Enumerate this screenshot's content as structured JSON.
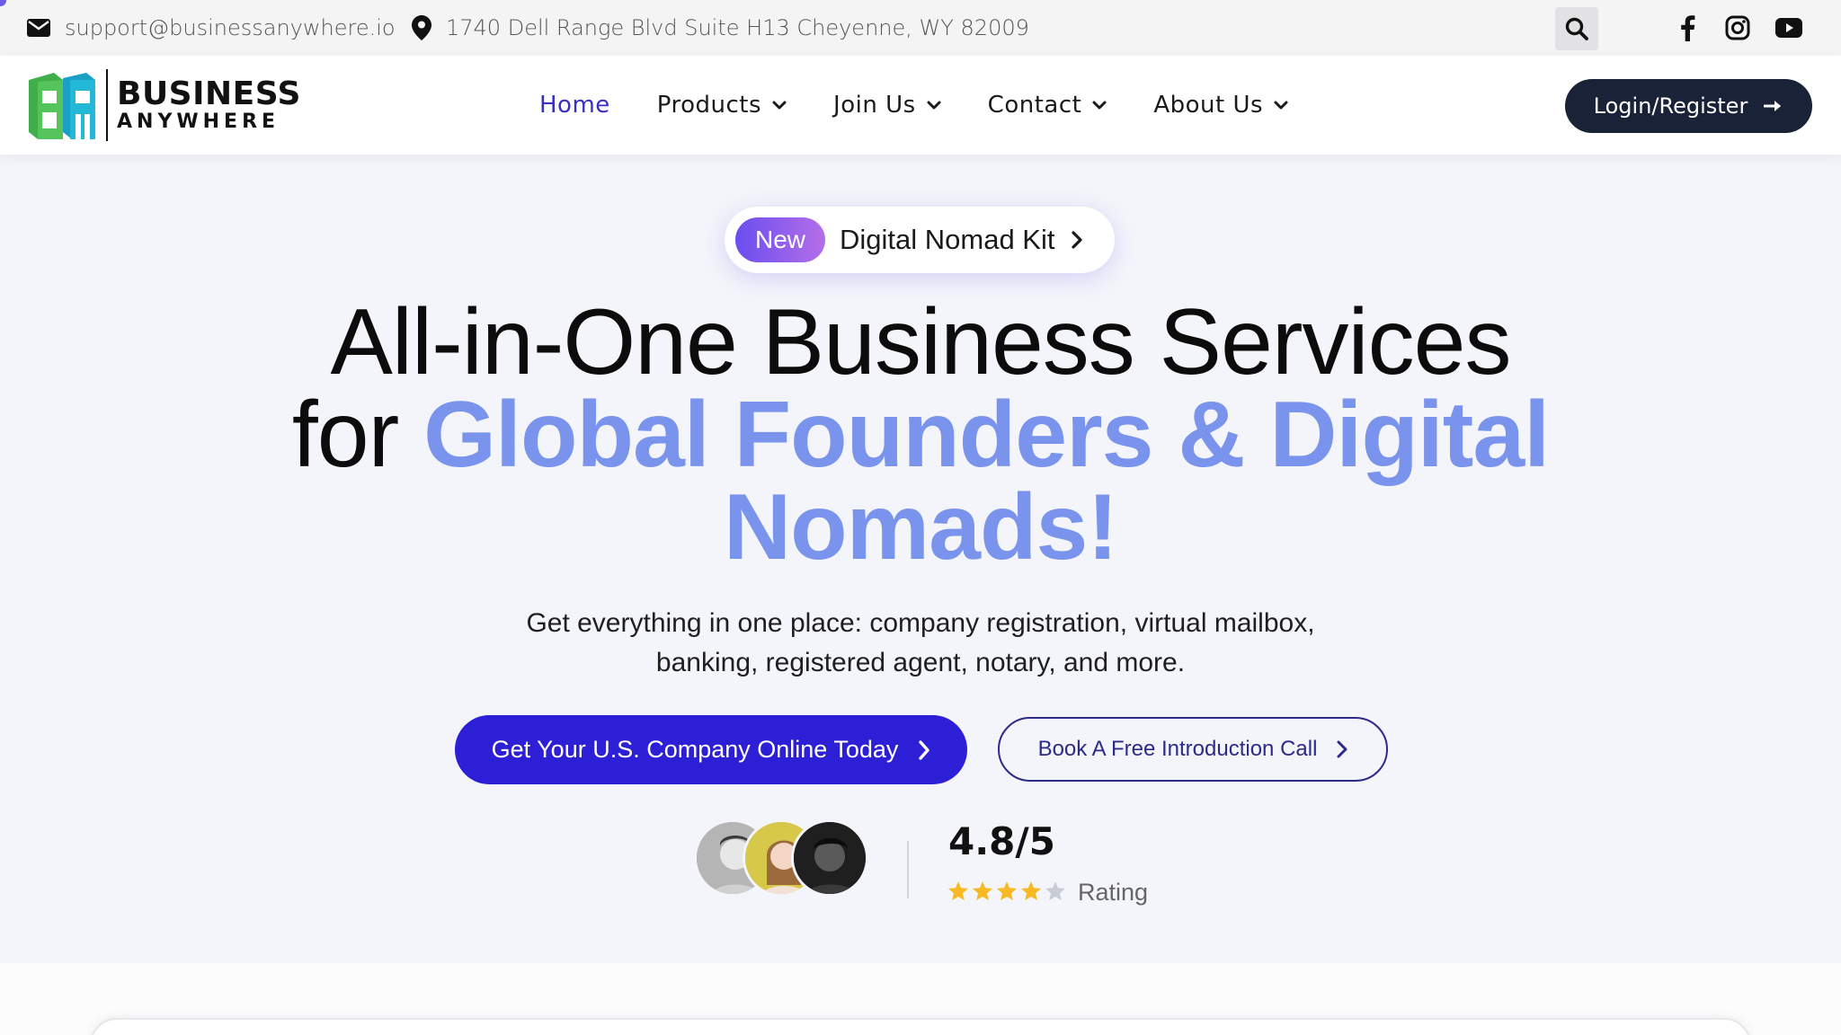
{
  "topbar": {
    "email": "support@businessanywhere.io",
    "address": "1740 Dell Range Blvd Suite H13 Cheyenne, WY 82009",
    "icons": [
      "envelope-icon",
      "map-pin-icon",
      "search-icon",
      "facebook-icon",
      "instagram-icon",
      "youtube-icon"
    ]
  },
  "header": {
    "logo": {
      "line1": "BUSINESS",
      "line2": "ANYWHERE"
    },
    "nav": [
      {
        "label": "Home",
        "active": true
      },
      {
        "label": "Products",
        "dropdown": true
      },
      {
        "label": "Join Us",
        "dropdown": true
      },
      {
        "label": "Contact",
        "dropdown": true
      },
      {
        "label": "About Us",
        "dropdown": true
      }
    ],
    "login_label": "Login/Register"
  },
  "hero": {
    "badge": {
      "tag": "New",
      "label": "Digital Nomad Kit"
    },
    "headline": {
      "line1": "All-in-One Business Services",
      "for_word": "for",
      "accent1": "Global Founders & Digital",
      "accent2": "Nomads!"
    },
    "subtext_line1": "Get everything in one place: company registration, virtual mailbox,",
    "subtext_line2": "banking, registered agent, notary, and more.",
    "cta_primary": "Get Your U.S. Company Online Today",
    "cta_secondary": "Book A Free Introduction Call",
    "rating": {
      "value": "4.8/5",
      "stars_filled": 4,
      "stars_total": 5,
      "label": "Rating"
    }
  },
  "colors": {
    "accent": "#7a93ec",
    "primary_button": "#2c1fd6",
    "active_nav": "#3a2fc4",
    "login_button": "#1a2238",
    "star": "#f7b924"
  }
}
